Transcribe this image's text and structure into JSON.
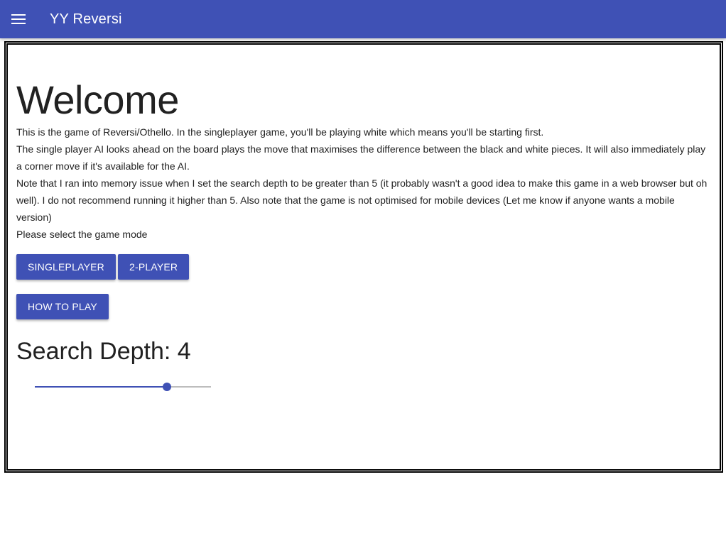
{
  "app_bar": {
    "title": "YY Reversi",
    "color": "#3f51b5"
  },
  "menu": {
    "icon": "menu-icon"
  },
  "main": {
    "heading": "Welcome",
    "paragraphs": [
      "This is the game of Reversi/Othello. In the singleplayer game, you'll be playing white which means you'll be starting first.",
      "The single player AI looks ahead on the board plays the move that maximises the difference between the black and white pieces. It will also immediately play a corner move if it's available for the AI.",
      "Note that I ran into memory issue when I set the search depth to be greater than 5 (it probably wasn't a good idea to make this game in a web browser but oh well). I do not recommend running it higher than 5. Also note that the game is not optimised for mobile devices (Let me know if anyone wants a mobile version)",
      "Please select the game mode"
    ],
    "buttons": {
      "singleplayer": "Singleplayer",
      "two_player": "2-Player",
      "how_to_play": "How To Play"
    },
    "search_depth": {
      "label": "Search Depth: ",
      "value": "4"
    },
    "slider": {
      "fraction": 0.75,
      "accent_color": "#3f51b5"
    }
  }
}
